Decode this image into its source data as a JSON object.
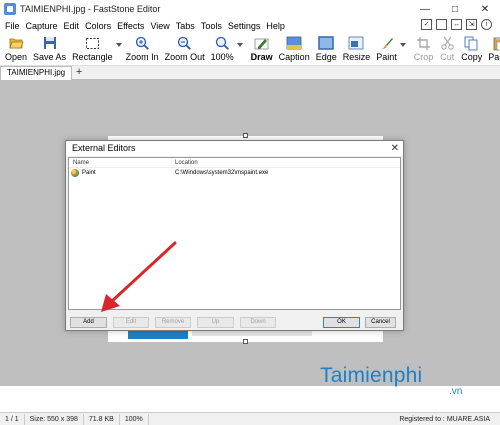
{
  "window": {
    "title": "TAIMIENPHI.jpg - FastStone Editor",
    "controls": [
      "—",
      "□",
      "✕"
    ]
  },
  "menu": [
    "File",
    "Capture",
    "Edit",
    "Colors",
    "Effects",
    "View",
    "Tabs",
    "Tools",
    "Settings",
    "Help"
  ],
  "toolbar": {
    "open": "Open",
    "save_as": "Save As",
    "rectangle": "Rectangle",
    "zoom_in": "Zoom In",
    "zoom_out": "Zoom Out",
    "zoom_level": "100%",
    "draw": "Draw",
    "caption": "Caption",
    "edge": "Edge",
    "resize": "Resize",
    "paint": "Paint",
    "crop": "Crop",
    "cut": "Cut",
    "copy": "Copy",
    "paste": "Paste"
  },
  "tabs": {
    "active": "TAIMIENPHI.jpg",
    "add": "+"
  },
  "dialog": {
    "title": "External Editors",
    "close": "✕",
    "columns": {
      "name": "Name",
      "location": "Location"
    },
    "rows": [
      {
        "name": "Paint",
        "location": "C:\\Windows\\system32\\mspaint.exe"
      }
    ],
    "buttons": {
      "add": "Add",
      "edit": "Edit",
      "remove": "Remove",
      "up": "Up",
      "down": "Down",
      "ok": "OK",
      "cancel": "Cancel"
    }
  },
  "watermark": {
    "title": "Taimienphi",
    "sub": ".vn"
  },
  "status": {
    "page": "1 / 1",
    "size": "Size: 550 x 398",
    "file_size": "71.8 KB",
    "zoom": "100%",
    "registered": "Registered to : MUARE.ASIA"
  },
  "colors": {
    "accent": "#1f80c8",
    "arrow": "#d9262b",
    "canvas": "#bfbfbf"
  }
}
